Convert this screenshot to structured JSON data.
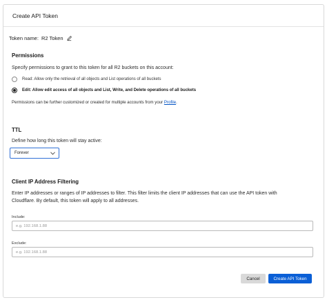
{
  "header": {
    "title": "Create API Token"
  },
  "token_name": {
    "label": "Token name:",
    "value": "R2 Token"
  },
  "permissions": {
    "title": "Permissions",
    "description": "Specify permissions to grant to this token for all R2 buckets on this account:",
    "options": [
      {
        "label": "Read: Allow only the retrieval of all objects and List operations of all buckets",
        "selected": false
      },
      {
        "label": "Edit: Allow edit access of all objects and List, Write, and Delete operations of all buckets",
        "selected": true
      }
    ],
    "note_prefix": "Permissions can be further customized or created for multiple accounts from your",
    "note_link": "Profile",
    "note_suffix": "."
  },
  "ttl": {
    "title": "TTL",
    "description": "Define how long this token will stay active:",
    "selected": "Forever"
  },
  "ip_filter": {
    "title": "Client IP Address Filtering",
    "description_line1": "Enter IP addresses or ranges of IP addresses to filter. This filter limits the client IP addresses that can use the API token with",
    "description_line2": "Cloudflare. By default, this token will apply to all addresses.",
    "include_label": "Include:",
    "include_placeholder": "e.g. 192.168.1.88",
    "exclude_label": "Exclude:",
    "exclude_placeholder": "e.g. 192.168.1.88"
  },
  "actions": {
    "cancel": "Cancel",
    "create": "Create API Token"
  },
  "colors": {
    "primary": "#0a5fd6",
    "link": "#0051c3",
    "cancel_bg": "#d9d9d9",
    "select_border": "#2f6fd6"
  }
}
